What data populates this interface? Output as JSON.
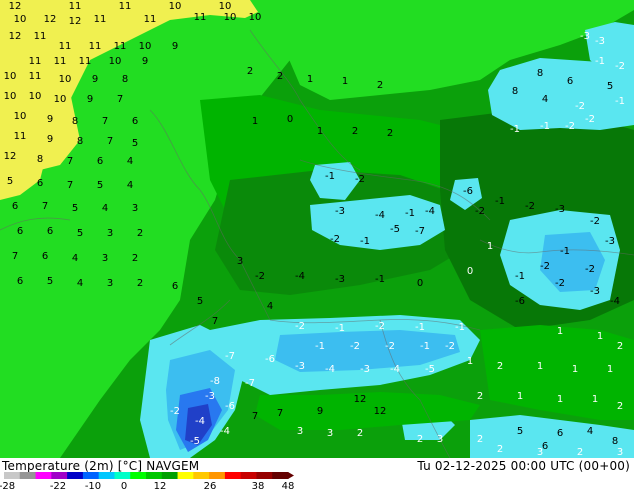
{
  "footer": {
    "title": "Temperature (2m) [°C] NAVGEM",
    "time": "Tu 02-12-2025 00:00 UTC (00+00)"
  },
  "legend": {
    "ticks": [
      "-28",
      "-22",
      "-10",
      "0",
      "12",
      "26",
      "38",
      "48"
    ],
    "colors": [
      "#c8c8c8",
      "#969696",
      "#ff00ff",
      "#a000c8",
      "#0000c8",
      "#0064ff",
      "#00c8ff",
      "#00ffc8",
      "#00ff00",
      "#00c800",
      "#00a000",
      "#ffff00",
      "#ffc800",
      "#ff9600",
      "#ff0000",
      "#c80000",
      "#960000",
      "#640000"
    ]
  },
  "palette": {
    "bright_green": "#22dd22",
    "green": "#00b400",
    "mid_green": "#0ba00b",
    "dark_green": "#0a8a0a",
    "darker_green": "#077807",
    "cyan": "#5ae6f0",
    "light_blue": "#3cbef0",
    "blue": "#2878f0",
    "dark_blue": "#2040c8",
    "yellow": "#f0f050"
  },
  "labels": [
    {
      "t": "12",
      "c": "#000"
    },
    {
      "t": "11",
      "c": "#000"
    },
    {
      "t": "11",
      "c": "#000"
    },
    {
      "t": "10",
      "c": "#000"
    },
    {
      "t": "10",
      "c": "#000"
    },
    {
      "t": "10",
      "c": "#000"
    },
    {
      "t": "12",
      "c": "#000"
    },
    {
      "t": "12",
      "c": "#000"
    },
    {
      "t": "11",
      "c": "#000"
    },
    {
      "t": "11",
      "c": "#000"
    },
    {
      "t": "11",
      "c": "#000"
    },
    {
      "t": "10",
      "c": "#000"
    },
    {
      "t": "10",
      "c": "#000"
    },
    {
      "t": "12",
      "c": "#000"
    },
    {
      "t": "11",
      "c": "#000"
    },
    {
      "t": "11",
      "c": "#000"
    },
    {
      "t": "11",
      "c": "#000"
    },
    {
      "t": "11",
      "c": "#000"
    },
    {
      "t": "10",
      "c": "#000"
    },
    {
      "t": "9",
      "c": "#000"
    },
    {
      "t": "11",
      "c": "#000"
    },
    {
      "t": "11",
      "c": "#000"
    },
    {
      "t": "11",
      "c": "#000"
    },
    {
      "t": "10",
      "c": "#000"
    },
    {
      "t": "9",
      "c": "#000"
    },
    {
      "t": "10",
      "c": "#000"
    },
    {
      "t": "11",
      "c": "#000"
    },
    {
      "t": "10",
      "c": "#000"
    },
    {
      "t": "9",
      "c": "#000"
    },
    {
      "t": "8",
      "c": "#000"
    },
    {
      "t": "10",
      "c": "#000"
    },
    {
      "t": "10",
      "c": "#000"
    },
    {
      "t": "10",
      "c": "#000"
    },
    {
      "t": "9",
      "c": "#000"
    },
    {
      "t": "7",
      "c": "#000"
    },
    {
      "t": "10",
      "c": "#000"
    },
    {
      "t": "9",
      "c": "#000"
    },
    {
      "t": "8",
      "c": "#000"
    },
    {
      "t": "7",
      "c": "#000"
    },
    {
      "t": "6",
      "c": "#000"
    },
    {
      "t": "11",
      "c": "#000"
    },
    {
      "t": "9",
      "c": "#000"
    },
    {
      "t": "8",
      "c": "#000"
    },
    {
      "t": "7",
      "c": "#000"
    },
    {
      "t": "5",
      "c": "#000"
    },
    {
      "t": "12",
      "c": "#000"
    },
    {
      "t": "8",
      "c": "#000"
    },
    {
      "t": "7",
      "c": "#000"
    },
    {
      "t": "6",
      "c": "#000"
    },
    {
      "t": "4",
      "c": "#000"
    },
    {
      "t": "5",
      "c": "#000"
    },
    {
      "t": "6",
      "c": "#000"
    },
    {
      "t": "7",
      "c": "#000"
    },
    {
      "t": "5",
      "c": "#000"
    },
    {
      "t": "4",
      "c": "#000"
    },
    {
      "t": "6",
      "c": "#000"
    },
    {
      "t": "7",
      "c": "#000"
    },
    {
      "t": "5",
      "c": "#000"
    },
    {
      "t": "4",
      "c": "#000"
    },
    {
      "t": "3",
      "c": "#000"
    },
    {
      "t": "6",
      "c": "#000"
    },
    {
      "t": "6",
      "c": "#000"
    },
    {
      "t": "5",
      "c": "#000"
    },
    {
      "t": "3",
      "c": "#000"
    },
    {
      "t": "2",
      "c": "#000"
    },
    {
      "t": "7",
      "c": "#000"
    },
    {
      "t": "6",
      "c": "#000"
    },
    {
      "t": "4",
      "c": "#000"
    },
    {
      "t": "3",
      "c": "#000"
    },
    {
      "t": "2",
      "c": "#000"
    },
    {
      "t": "6",
      "c": "#000"
    },
    {
      "t": "5",
      "c": "#000"
    },
    {
      "t": "4",
      "c": "#000"
    },
    {
      "t": "3",
      "c": "#000"
    },
    {
      "t": "2",
      "c": "#000"
    },
    {
      "t": "2",
      "c": "#000"
    },
    {
      "t": "2",
      "c": "#000"
    },
    {
      "t": "1",
      "c": "#000"
    },
    {
      "t": "1",
      "c": "#000"
    },
    {
      "t": "2",
      "c": "#000"
    },
    {
      "t": "1",
      "c": "#000"
    },
    {
      "t": "0",
      "c": "#000"
    },
    {
      "t": "1",
      "c": "#000"
    },
    {
      "t": "2",
      "c": "#000"
    },
    {
      "t": "2",
      "c": "#000"
    },
    {
      "t": "-1",
      "c": "#000"
    },
    {
      "t": "-2",
      "c": "#000"
    },
    {
      "t": "-3",
      "c": "#000"
    },
    {
      "t": "-4",
      "c": "#000"
    },
    {
      "t": "-1",
      "c": "#000"
    },
    {
      "t": "-5",
      "c": "#000"
    },
    {
      "t": "-7",
      "c": "#000"
    },
    {
      "t": "-1",
      "c": "#000"
    },
    {
      "t": "-2",
      "c": "#000"
    },
    {
      "t": "-4",
      "c": "#000"
    },
    {
      "t": "-6",
      "c": "#000"
    },
    {
      "t": "-2",
      "c": "#000"
    },
    {
      "t": "-1",
      "c": "#000"
    },
    {
      "t": "-2",
      "c": "#000"
    },
    {
      "t": "-3",
      "c": "#000"
    },
    {
      "t": "-2",
      "c": "#000"
    },
    {
      "t": "-3",
      "c": "#000"
    },
    {
      "t": "-1",
      "c": "#000"
    },
    {
      "t": "-2",
      "c": "#000"
    },
    {
      "t": "-2",
      "c": "#000"
    },
    {
      "t": "-1",
      "c": "#000"
    },
    {
      "t": "-2",
      "c": "#000"
    },
    {
      "t": "-3",
      "c": "#000"
    },
    {
      "t": "-4",
      "c": "#000"
    },
    {
      "t": "-6",
      "c": "#000"
    },
    {
      "t": "-2",
      "c": "#000"
    },
    {
      "t": "-4",
      "c": "#000"
    },
    {
      "t": "-3",
      "c": "#000"
    },
    {
      "t": "-1",
      "c": "#000"
    },
    {
      "t": "0",
      "c": "#000"
    },
    {
      "t": "3",
      "c": "#000"
    },
    {
      "t": "4",
      "c": "#000"
    },
    {
      "t": "5",
      "c": "#000"
    },
    {
      "t": "6",
      "c": "#000"
    },
    {
      "t": "7",
      "c": "#000"
    },
    {
      "t": "8",
      "c": "#000"
    },
    {
      "t": "6",
      "c": "#000"
    },
    {
      "t": "5",
      "c": "#000"
    },
    {
      "t": "8",
      "c": "#000"
    },
    {
      "t": "4",
      "c": "#000"
    },
    {
      "t": "-2",
      "c": "#fff"
    },
    {
      "t": "-1",
      "c": "#fff"
    },
    {
      "t": "-1",
      "c": "#fff"
    },
    {
      "t": "-2",
      "c": "#fff"
    },
    {
      "t": "-3",
      "c": "#fff"
    },
    {
      "t": "-2",
      "c": "#fff"
    },
    {
      "t": "-3",
      "c": "#fff"
    },
    {
      "t": "-1",
      "c": "#fff"
    },
    {
      "t": "-1",
      "c": "#fff"
    },
    {
      "t": "-2",
      "c": "#fff"
    },
    {
      "t": "-2",
      "c": "#fff"
    },
    {
      "t": "-1",
      "c": "#fff"
    },
    {
      "t": "-2",
      "c": "#fff"
    },
    {
      "t": "-1",
      "c": "#fff"
    },
    {
      "t": "-1",
      "c": "#fff"
    },
    {
      "t": "-1",
      "c": "#fff"
    },
    {
      "t": "-2",
      "c": "#fff"
    },
    {
      "t": "-2",
      "c": "#fff"
    },
    {
      "t": "-1",
      "c": "#fff"
    },
    {
      "t": "-2",
      "c": "#fff"
    },
    {
      "t": "-3",
      "c": "#fff"
    },
    {
      "t": "-4",
      "c": "#fff"
    },
    {
      "t": "-3",
      "c": "#fff"
    },
    {
      "t": "-4",
      "c": "#fff"
    },
    {
      "t": "-5",
      "c": "#fff"
    },
    {
      "t": "-7",
      "c": "#fff"
    },
    {
      "t": "-6",
      "c": "#fff"
    },
    {
      "t": "-8",
      "c": "#fff"
    },
    {
      "t": "-7",
      "c": "#fff"
    },
    {
      "t": "-6",
      "c": "#fff"
    },
    {
      "t": "-4",
      "c": "#fff"
    },
    {
      "t": "-5",
      "c": "#fff"
    },
    {
      "t": "-3",
      "c": "#fff"
    },
    {
      "t": "-2",
      "c": "#fff"
    },
    {
      "t": "-4",
      "c": "#fff"
    },
    {
      "t": "1",
      "c": "#fff"
    },
    {
      "t": "2",
      "c": "#fff"
    },
    {
      "t": "1",
      "c": "#fff"
    },
    {
      "t": "1",
      "c": "#fff"
    },
    {
      "t": "1",
      "c": "#fff"
    },
    {
      "t": "2",
      "c": "#fff"
    },
    {
      "t": "1",
      "c": "#fff"
    },
    {
      "t": "1",
      "c": "#fff"
    },
    {
      "t": "1",
      "c": "#fff"
    },
    {
      "t": "2",
      "c": "#fff"
    },
    {
      "t": "1",
      "c": "#fff"
    },
    {
      "t": "0",
      "c": "#fff"
    },
    {
      "t": "1",
      "c": "#fff"
    },
    {
      "t": "1",
      "c": "#fff"
    },
    {
      "t": "2",
      "c": "#fff"
    },
    {
      "t": "3",
      "c": "#fff"
    },
    {
      "t": "3",
      "c": "#fff"
    },
    {
      "t": "2",
      "c": "#fff"
    },
    {
      "t": "2",
      "c": "#fff"
    },
    {
      "t": "3",
      "c": "#fff"
    },
    {
      "t": "7",
      "c": "#000"
    },
    {
      "t": "7",
      "c": "#000"
    },
    {
      "t": "9",
      "c": "#000"
    },
    {
      "t": "12",
      "c": "#000"
    },
    {
      "t": "12",
      "c": "#000"
    },
    {
      "t": "5",
      "c": "#000"
    },
    {
      "t": "6",
      "c": "#000"
    },
    {
      "t": "4",
      "c": "#000"
    },
    {
      "t": "8",
      "c": "#000"
    },
    {
      "t": "6",
      "c": "#000"
    },
    {
      "t": "2",
      "c": "#fff"
    },
    {
      "t": "2",
      "c": "#fff"
    },
    {
      "t": "3",
      "c": "#fff"
    },
    {
      "t": "2",
      "c": "#fff"
    },
    {
      "t": "3",
      "c": "#fff"
    },
    {
      "t": "-3",
      "c": "#fff"
    },
    {
      "t": "-1",
      "c": "#fff"
    },
    {
      "t": "-3",
      "c": "#fff"
    },
    {
      "t": "-2",
      "c": "#fff"
    },
    {
      "t": "-1",
      "c": "#fff"
    }
  ]
}
